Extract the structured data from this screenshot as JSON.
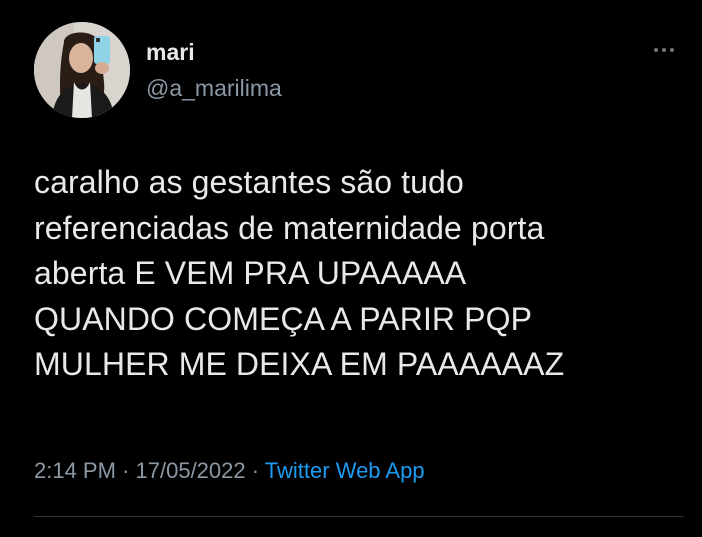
{
  "user": {
    "display_name": "mari",
    "handle": "@a_marilima"
  },
  "tweet": {
    "lines": [
      "caralho as gestantes são tudo",
      "referenciadas de maternidade porta",
      "aberta E VEM PRA UPAAAAA",
      "QUANDO COMEÇA A PARIR PQP",
      "MULHER ME DEIXA EM PAAAAAAZ"
    ],
    "time": "2:14 PM",
    "separator": "·",
    "date": "17/05/2022",
    "source": "Twitter Web App"
  },
  "icons": {
    "more": "more-options-icon",
    "avatar": "profile-photo"
  },
  "colors": {
    "background": "#000000",
    "text": "#e7e9ea",
    "secondary": "#8b98a5",
    "link": "#1d9bf0",
    "divider": "#2f3336"
  }
}
